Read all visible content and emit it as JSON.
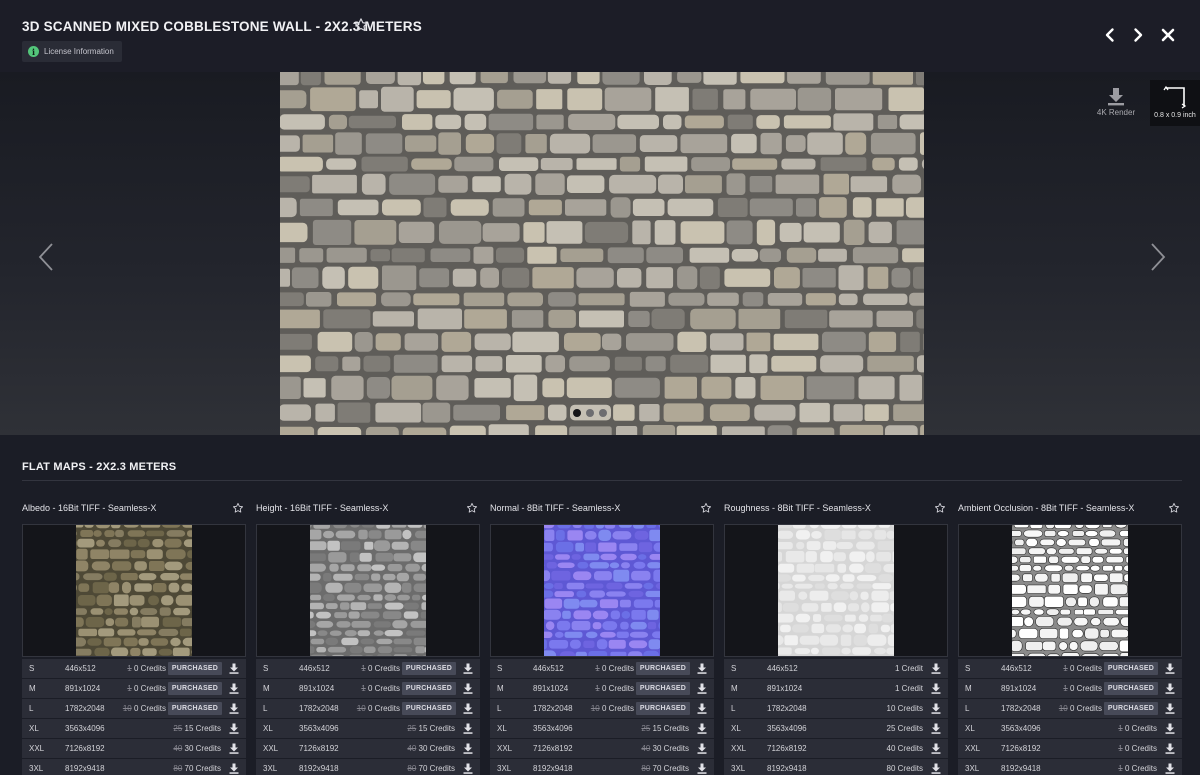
{
  "header": {
    "title": "3D SCANNED MIXED COBBLESTONE WALL - 2X2.3 METERS",
    "license_label": "License Information"
  },
  "viewer": {
    "render_label": "4K Render",
    "size_label": "0.8 x 0.9 inch",
    "slide_count": 3,
    "active_slide": 1
  },
  "section": {
    "title": "FLAT MAPS - 2X2.3 METERS"
  },
  "colors": {
    "accent_green": "#53c57a",
    "background": "#1b1d26",
    "row_bg": "#2b2d37",
    "badge_bg": "#474a58"
  },
  "maps": [
    {
      "title": "Albedo - 16Bit TIFF - Seamless-X",
      "thumb": "albedo",
      "rows": [
        {
          "size": "S",
          "res": "446x512",
          "old": "1",
          "credits": "0 Credits",
          "badge": "PURCHASED"
        },
        {
          "size": "M",
          "res": "891x1024",
          "old": "1",
          "credits": "0 Credits",
          "badge": "PURCHASED"
        },
        {
          "size": "L",
          "res": "1782x2048",
          "old": "10",
          "credits": "0 Credits",
          "badge": "PURCHASED"
        },
        {
          "size": "XL",
          "res": "3563x4096",
          "old": "25",
          "credits": "15 Credits",
          "badge": ""
        },
        {
          "size": "XXL",
          "res": "7126x8192",
          "old": "40",
          "credits": "30 Credits",
          "badge": ""
        },
        {
          "size": "3XL",
          "res": "8192x9418",
          "old": "80",
          "credits": "70 Credits",
          "badge": ""
        }
      ]
    },
    {
      "title": "Height - 16Bit TIFF - Seamless-X",
      "thumb": "height",
      "rows": [
        {
          "size": "S",
          "res": "446x512",
          "old": "1",
          "credits": "0 Credits",
          "badge": "PURCHASED"
        },
        {
          "size": "M",
          "res": "891x1024",
          "old": "1",
          "credits": "0 Credits",
          "badge": "PURCHASED"
        },
        {
          "size": "L",
          "res": "1782x2048",
          "old": "10",
          "credits": "0 Credits",
          "badge": "PURCHASED"
        },
        {
          "size": "XL",
          "res": "3563x4096",
          "old": "25",
          "credits": "15 Credits",
          "badge": ""
        },
        {
          "size": "XXL",
          "res": "7126x8192",
          "old": "40",
          "credits": "30 Credits",
          "badge": ""
        },
        {
          "size": "3XL",
          "res": "8192x9418",
          "old": "80",
          "credits": "70 Credits",
          "badge": ""
        }
      ]
    },
    {
      "title": "Normal - 8Bit TIFF - Seamless-X",
      "thumb": "normal",
      "rows": [
        {
          "size": "S",
          "res": "446x512",
          "old": "1",
          "credits": "0 Credits",
          "badge": "PURCHASED"
        },
        {
          "size": "M",
          "res": "891x1024",
          "old": "1",
          "credits": "0 Credits",
          "badge": "PURCHASED"
        },
        {
          "size": "L",
          "res": "1782x2048",
          "old": "10",
          "credits": "0 Credits",
          "badge": "PURCHASED"
        },
        {
          "size": "XL",
          "res": "3563x4096",
          "old": "25",
          "credits": "15 Credits",
          "badge": ""
        },
        {
          "size": "XXL",
          "res": "7126x8192",
          "old": "40",
          "credits": "30 Credits",
          "badge": ""
        },
        {
          "size": "3XL",
          "res": "8192x9418",
          "old": "80",
          "credits": "70 Credits",
          "badge": ""
        }
      ]
    },
    {
      "title": "Roughness - 8Bit TIFF - Seamless-X",
      "thumb": "roughness",
      "rows": [
        {
          "size": "S",
          "res": "446x512",
          "old": "",
          "credits": "1 Credit",
          "badge": ""
        },
        {
          "size": "M",
          "res": "891x1024",
          "old": "",
          "credits": "1 Credit",
          "badge": ""
        },
        {
          "size": "L",
          "res": "1782x2048",
          "old": "",
          "credits": "10 Credits",
          "badge": ""
        },
        {
          "size": "XL",
          "res": "3563x4096",
          "old": "",
          "credits": "25 Credits",
          "badge": ""
        },
        {
          "size": "XXL",
          "res": "7126x8192",
          "old": "",
          "credits": "40 Credits",
          "badge": ""
        },
        {
          "size": "3XL",
          "res": "8192x9418",
          "old": "",
          "credits": "80 Credits",
          "badge": ""
        }
      ]
    },
    {
      "title": "Ambient Occlusion - 8Bit TIFF - Seamless-X",
      "thumb": "ao",
      "rows": [
        {
          "size": "S",
          "res": "446x512",
          "old": "1",
          "credits": "0 Credits",
          "badge": "PURCHASED"
        },
        {
          "size": "M",
          "res": "891x1024",
          "old": "1",
          "credits": "0 Credits",
          "badge": "PURCHASED"
        },
        {
          "size": "L",
          "res": "1782x2048",
          "old": "10",
          "credits": "0 Credits",
          "badge": "PURCHASED"
        },
        {
          "size": "XL",
          "res": "3563x4096",
          "old": "1",
          "credits": "0 Credits",
          "badge": ""
        },
        {
          "size": "XXL",
          "res": "7126x8192",
          "old": "1",
          "credits": "0 Credits",
          "badge": ""
        },
        {
          "size": "3XL",
          "res": "8192x9418",
          "old": "1",
          "credits": "0 Credits",
          "badge": ""
        }
      ]
    }
  ]
}
